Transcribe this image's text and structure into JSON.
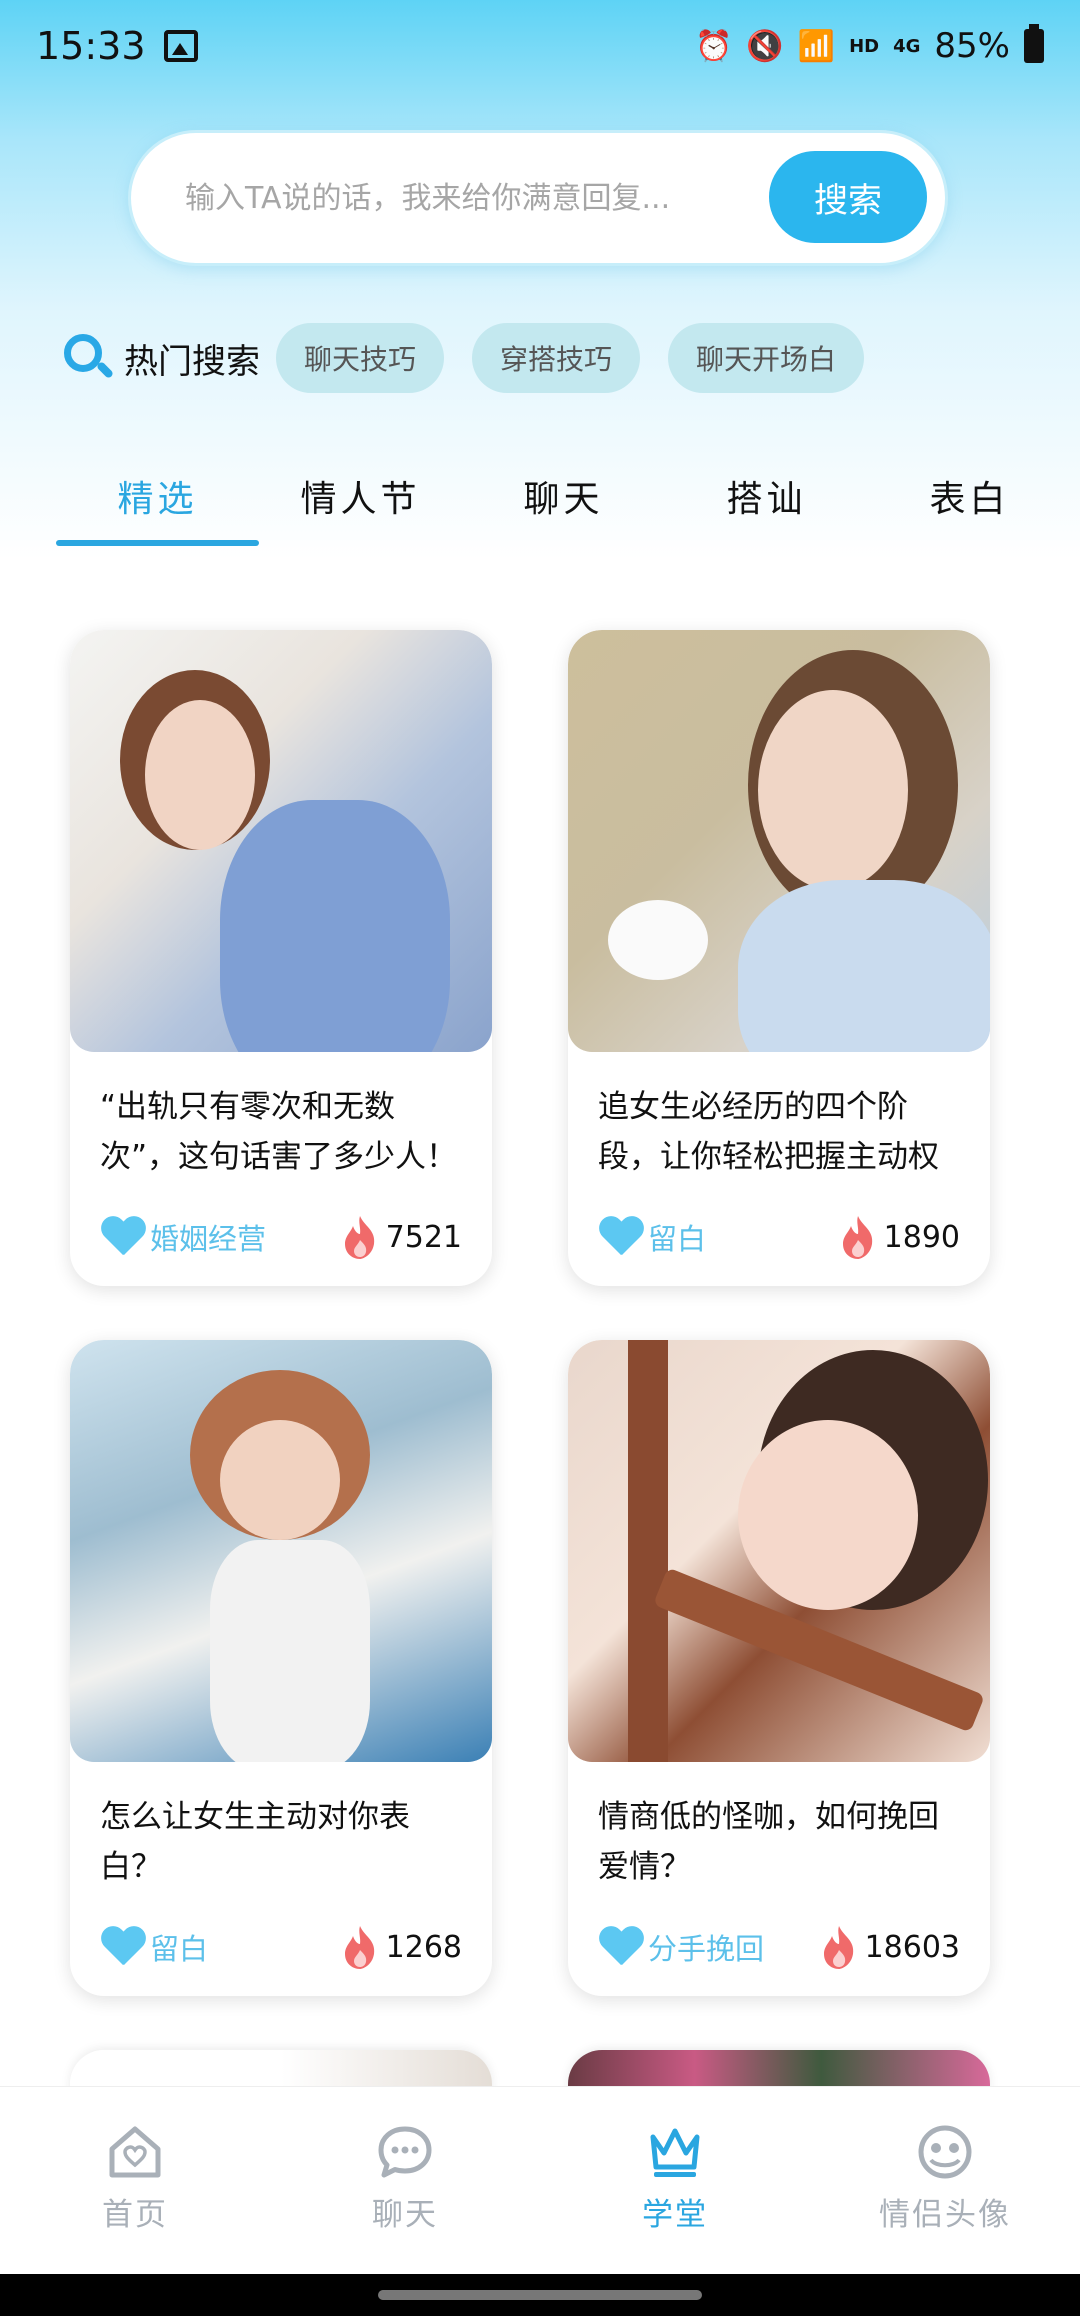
{
  "status_bar": {
    "time": "15:33",
    "network": "4G",
    "hd": "HD",
    "battery": "85%"
  },
  "search": {
    "placeholder": "输入TA说的话，我来给你满意回复...",
    "button_label": "搜索"
  },
  "hot_search": {
    "label": "热门搜索",
    "tags": [
      "聊天技巧",
      "穿搭技巧",
      "聊天开场白"
    ]
  },
  "tabs": [
    {
      "label": "精选",
      "active": true
    },
    {
      "label": "情人节",
      "active": false
    },
    {
      "label": "聊天",
      "active": false
    },
    {
      "label": "搭讪",
      "active": false
    },
    {
      "label": "表白",
      "active": false
    }
  ],
  "cards": [
    {
      "title": "“出轨只有零次和无数次”，这句话害了多少人！",
      "tag": "婚姻经营",
      "count": "7521"
    },
    {
      "title": "追女生必经历的四个阶段，让你轻松把握主动权",
      "tag": "留白",
      "count": "1890"
    },
    {
      "title": "怎么让女生主动对你表白？",
      "tag": "留白",
      "count": "1268"
    },
    {
      "title": "情商低的怪咖，如何挽回爱情？",
      "tag": "分手挽回",
      "count": "18603"
    }
  ],
  "bottom_nav": [
    {
      "label": "首页",
      "icon": "home-icon",
      "active": false
    },
    {
      "label": "聊天",
      "icon": "chat-icon",
      "active": false
    },
    {
      "label": "学堂",
      "icon": "crown-icon",
      "active": true
    },
    {
      "label": "情侣头像",
      "icon": "avatar-icon",
      "active": false
    }
  ],
  "colors": {
    "accent": "#2aa6e0",
    "search_button": "#2bb6ee",
    "tag_bg": "#c3e8ef",
    "heart": "#5cc8f2",
    "fire": "#f06a6a",
    "nav_inactive": "#a9b0b8"
  }
}
